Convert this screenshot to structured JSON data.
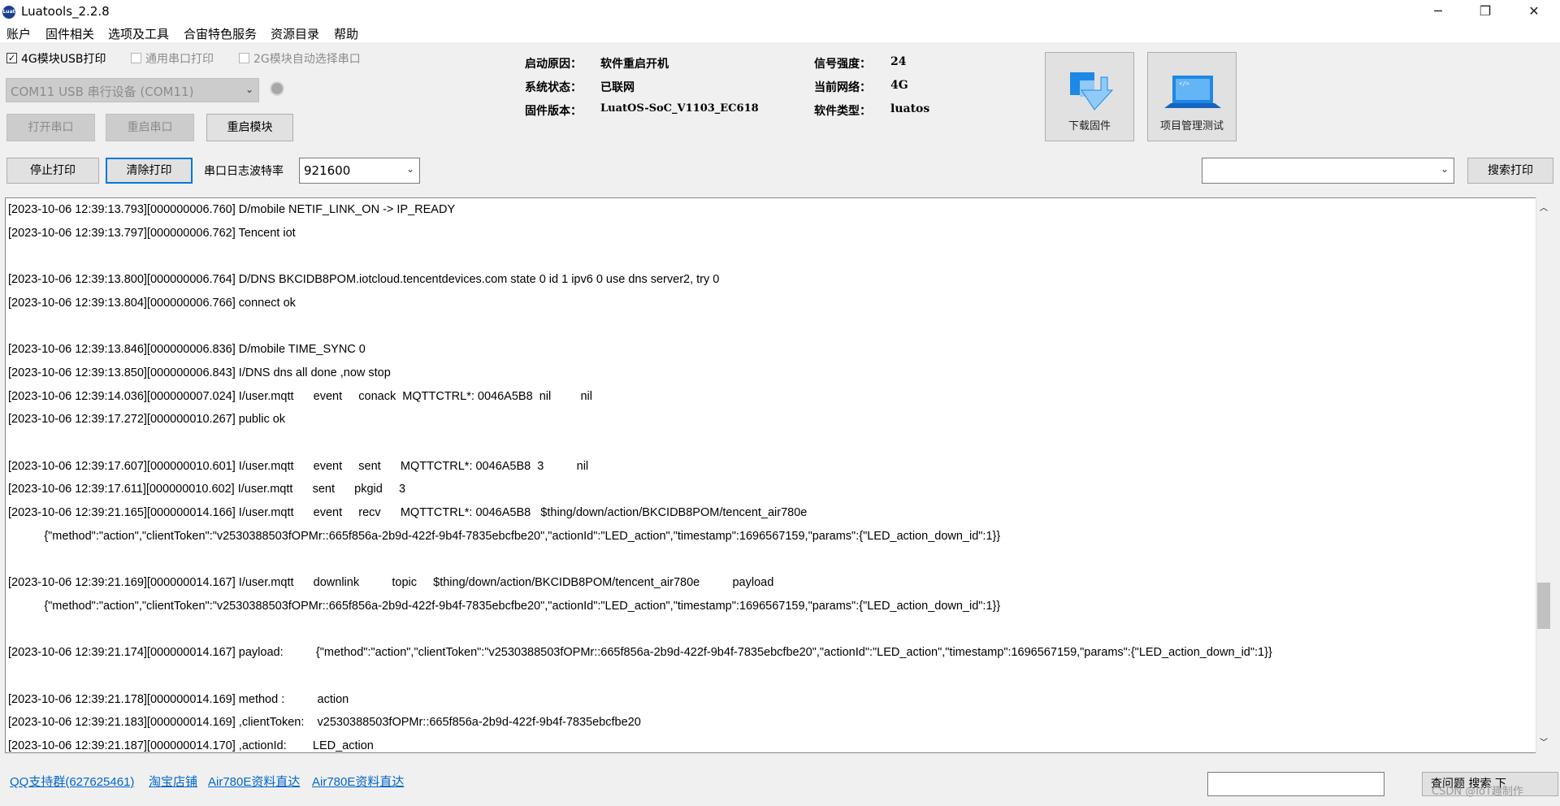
{
  "window": {
    "title": "Luatools_2.2.8",
    "icon_text": "Luat",
    "minimize": "─",
    "maximize": "❐",
    "close": "✕"
  },
  "menu": [
    "账户",
    "固件相关",
    "选项及工具",
    "合宙特色服务",
    "资源目录",
    "帮助"
  ],
  "options": {
    "usb_print": {
      "label": "4G模块USB打印",
      "checked": true
    },
    "serial_print": {
      "label": "通用串口打印",
      "checked": false
    },
    "auto_select": {
      "label": "2G模块自动选择串口",
      "checked": false
    }
  },
  "port_combo": {
    "value": "COM11 USB 串行设备 (COM11)"
  },
  "buttons": {
    "open_port": "打开串口",
    "restart_port": "重启串口",
    "restart_module": "重启模块",
    "stop_print": "停止打印",
    "clear_print": "清除打印",
    "search_print": "搜索打印",
    "bottom_btn": "查问题 搜索 下"
  },
  "baud": {
    "label": "串口日志波特率",
    "value": "921600"
  },
  "info": {
    "boot_reason_label": "启动原因：",
    "boot_reason": "软件重启开机",
    "system_state_label": "系统状态：",
    "system_state": "已联网",
    "firmware_label": "固件版本：",
    "firmware": "LuatOS-SoC_V1103_EC618",
    "signal_label": "信号强度：",
    "signal": "24",
    "network_label": "当前网络：",
    "network": "4G",
    "software_type_label": "软件类型：",
    "software_type": "luatos"
  },
  "big_buttons": {
    "download_firmware": "下载固件",
    "project_test": "项目管理测试"
  },
  "log_lines": [
    "[2023-10-06 12:39:13.793][000000006.760] D/mobile NETIF_LINK_ON -> IP_READY",
    "[2023-10-06 12:39:13.797][000000006.762] Tencent iot",
    "",
    "[2023-10-06 12:39:13.800][000000006.764] D/DNS BKCIDB8POM.iotcloud.tencentdevices.com state 0 id 1 ipv6 0 use dns server2, try 0",
    "[2023-10-06 12:39:13.804][000000006.766] connect ok",
    "",
    "[2023-10-06 12:39:13.846][000000006.836] D/mobile TIME_SYNC 0",
    "[2023-10-06 12:39:13.850][000000006.843] I/DNS dns all done ,now stop",
    "[2023-10-06 12:39:14.036][000000007.024] I/user.mqtt      event     conack  MQTTCTRL*: 0046A5B8  nil         nil",
    "[2023-10-06 12:39:17.272][000000010.267] public ok",
    "",
    "[2023-10-06 12:39:17.607][000000010.601] I/user.mqtt      event     sent      MQTTCTRL*: 0046A5B8  3          nil",
    "[2023-10-06 12:39:17.611][000000010.602] I/user.mqtt      sent      pkgid     3",
    "[2023-10-06 12:39:21.165][000000014.166] I/user.mqtt      event     recv      MQTTCTRL*: 0046A5B8   $thing/down/action/BKCIDB8POM/tencent_air780e",
    "           {\"method\":\"action\",\"clientToken\":\"v2530388503fOPMr::665f856a-2b9d-422f-9b4f-7835ebcfbe20\",\"actionId\":\"LED_action\",\"timestamp\":1696567159,\"params\":{\"LED_action_down_id\":1}}",
    "",
    "[2023-10-06 12:39:21.169][000000014.167] I/user.mqtt      downlink          topic     $thing/down/action/BKCIDB8POM/tencent_air780e          payload",
    "           {\"method\":\"action\",\"clientToken\":\"v2530388503fOPMr::665f856a-2b9d-422f-9b4f-7835ebcfbe20\",\"actionId\":\"LED_action\",\"timestamp\":1696567159,\"params\":{\"LED_action_down_id\":1}}",
    "",
    "[2023-10-06 12:39:21.174][000000014.167] payload:          {\"method\":\"action\",\"clientToken\":\"v2530388503fOPMr::665f856a-2b9d-422f-9b4f-7835ebcfbe20\",\"actionId\":\"LED_action\",\"timestamp\":1696567159,\"params\":{\"LED_action_down_id\":1}}",
    "",
    "[2023-10-06 12:39:21.178][000000014.169] method :          action",
    "[2023-10-06 12:39:21.183][000000014.169] ,clientToken:    v2530388503fOPMr::665f856a-2b9d-422f-9b4f-7835ebcfbe20",
    "[2023-10-06 12:39:21.187][000000014.170] ,actionId:        LED_action"
  ],
  "links": [
    "QQ支持群(627625461)",
    "淘宝店铺",
    "Air780E资料直达",
    "Air780E资料直达"
  ],
  "watermark": "CSDN @IoT趣制作"
}
